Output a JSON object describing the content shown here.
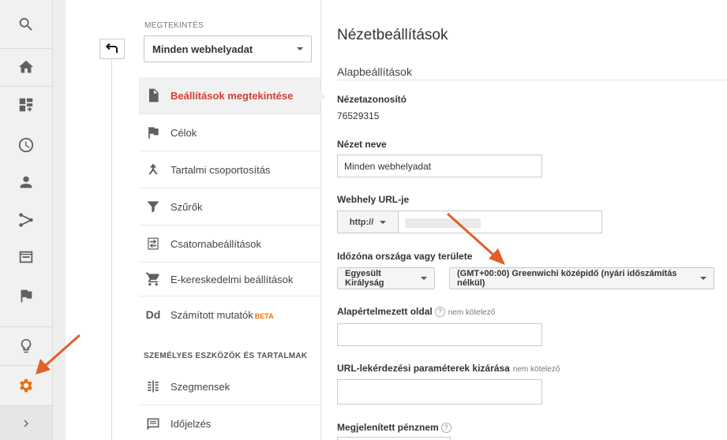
{
  "rail": {
    "icons": [
      "search-icon",
      "home-icon",
      "dashboard-add-icon",
      "clock-icon",
      "person-icon",
      "share-flow-icon",
      "browser-window-icon",
      "flag-icon",
      "lightbulb-icon",
      "gear-icon",
      "chevron-right-icon"
    ],
    "accent": "#e8710a"
  },
  "nav": {
    "caption": "MEGTEKINTÉS",
    "view_select": "Minden webhelyadat",
    "items": [
      {
        "label": "Beállítások megtekintése",
        "icon": "document-icon",
        "active": true
      },
      {
        "label": "Célok",
        "icon": "flag-icon"
      },
      {
        "label": "Tartalmi csoportosítás",
        "icon": "grouping-icon"
      },
      {
        "label": "Szűrők",
        "icon": "filter-icon"
      },
      {
        "label": "Csatornabeállítások",
        "icon": "channel-settings-icon"
      },
      {
        "label": "E-kereskedelmi beállítások",
        "icon": "cart-icon"
      },
      {
        "label": "Számított mutatók",
        "icon": "dd-icon",
        "badge": "BETA"
      },
      {
        "label": "Szegmensek",
        "icon": "segments-icon"
      },
      {
        "label": "Időjelzés",
        "icon": "annotation-icon"
      }
    ],
    "dd_glyph": "Dd",
    "section_title": "SZEMÉLYES ESZKÖZÖK ÉS TARTALMAK"
  },
  "main": {
    "title": "Nézetbeállítások",
    "subtitle": "Alapbeállítások",
    "view_id_label": "Nézetazonosító",
    "view_id": "76529315",
    "view_name_label": "Nézet neve",
    "view_name": "Minden webhelyadat",
    "url_label": "Webhely URL-je",
    "protocol": "http://",
    "timezone_label": "Időzóna országa vagy területe",
    "country": "Egyesült Királyság",
    "timezone": "(GMT+00:00) Greenwichi középidő (nyári időszámítás nélkül)",
    "default_page_label": "Alapértelmezett oldal",
    "optional": "nem kötelező",
    "exclude_params_label": "URL-lekérdezési paraméterek kizárása",
    "currency_label": "Megjelenített pénznem",
    "help_glyph": "?"
  },
  "colors": {
    "active_text": "#d23f31",
    "arrow": "#e0602c"
  }
}
